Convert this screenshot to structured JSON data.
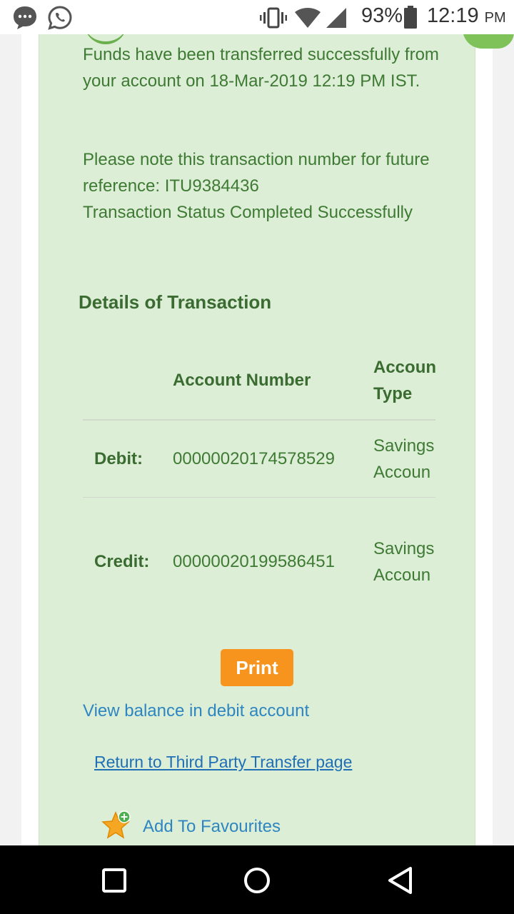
{
  "status_bar": {
    "battery": "93%",
    "time": "12:19",
    "ampm": "PM",
    "icons": [
      "messages-icon",
      "whatsapp-icon",
      "vibrate-icon",
      "wifi-icon",
      "signal-icon",
      "battery-icon"
    ]
  },
  "message": {
    "line1": "Funds have been transferred successfully from your account on 18-Mar-2019 12:19 PM IST.",
    "line2a": "Please note this transaction number for future reference: ITU9384436",
    "line2b": "Transaction Status Completed Successfully"
  },
  "details": {
    "title": "Details of Transaction",
    "headers": {
      "account_number": "Account Number",
      "account_type_1": "Accoun",
      "account_type_2": "Type"
    },
    "rows": [
      {
        "label": "Debit:",
        "account_number": "00000020174578529",
        "type_1": "Savings",
        "type_2": "Accoun"
      },
      {
        "label": "Credit:",
        "account_number": "00000020199586451",
        "type_1": "Savings",
        "type_2": "Accoun"
      }
    ]
  },
  "actions": {
    "print_label": "Print",
    "view_balance": "View balance in debit account",
    "return_link": "Return to Third Party Transfer page",
    "add_favourites": "Add To Favourites"
  },
  "colors": {
    "panel": "#ddeed7",
    "text_green": "#3e7a33",
    "print_button": "#f7941d",
    "link_blue": "#2e86c1"
  }
}
